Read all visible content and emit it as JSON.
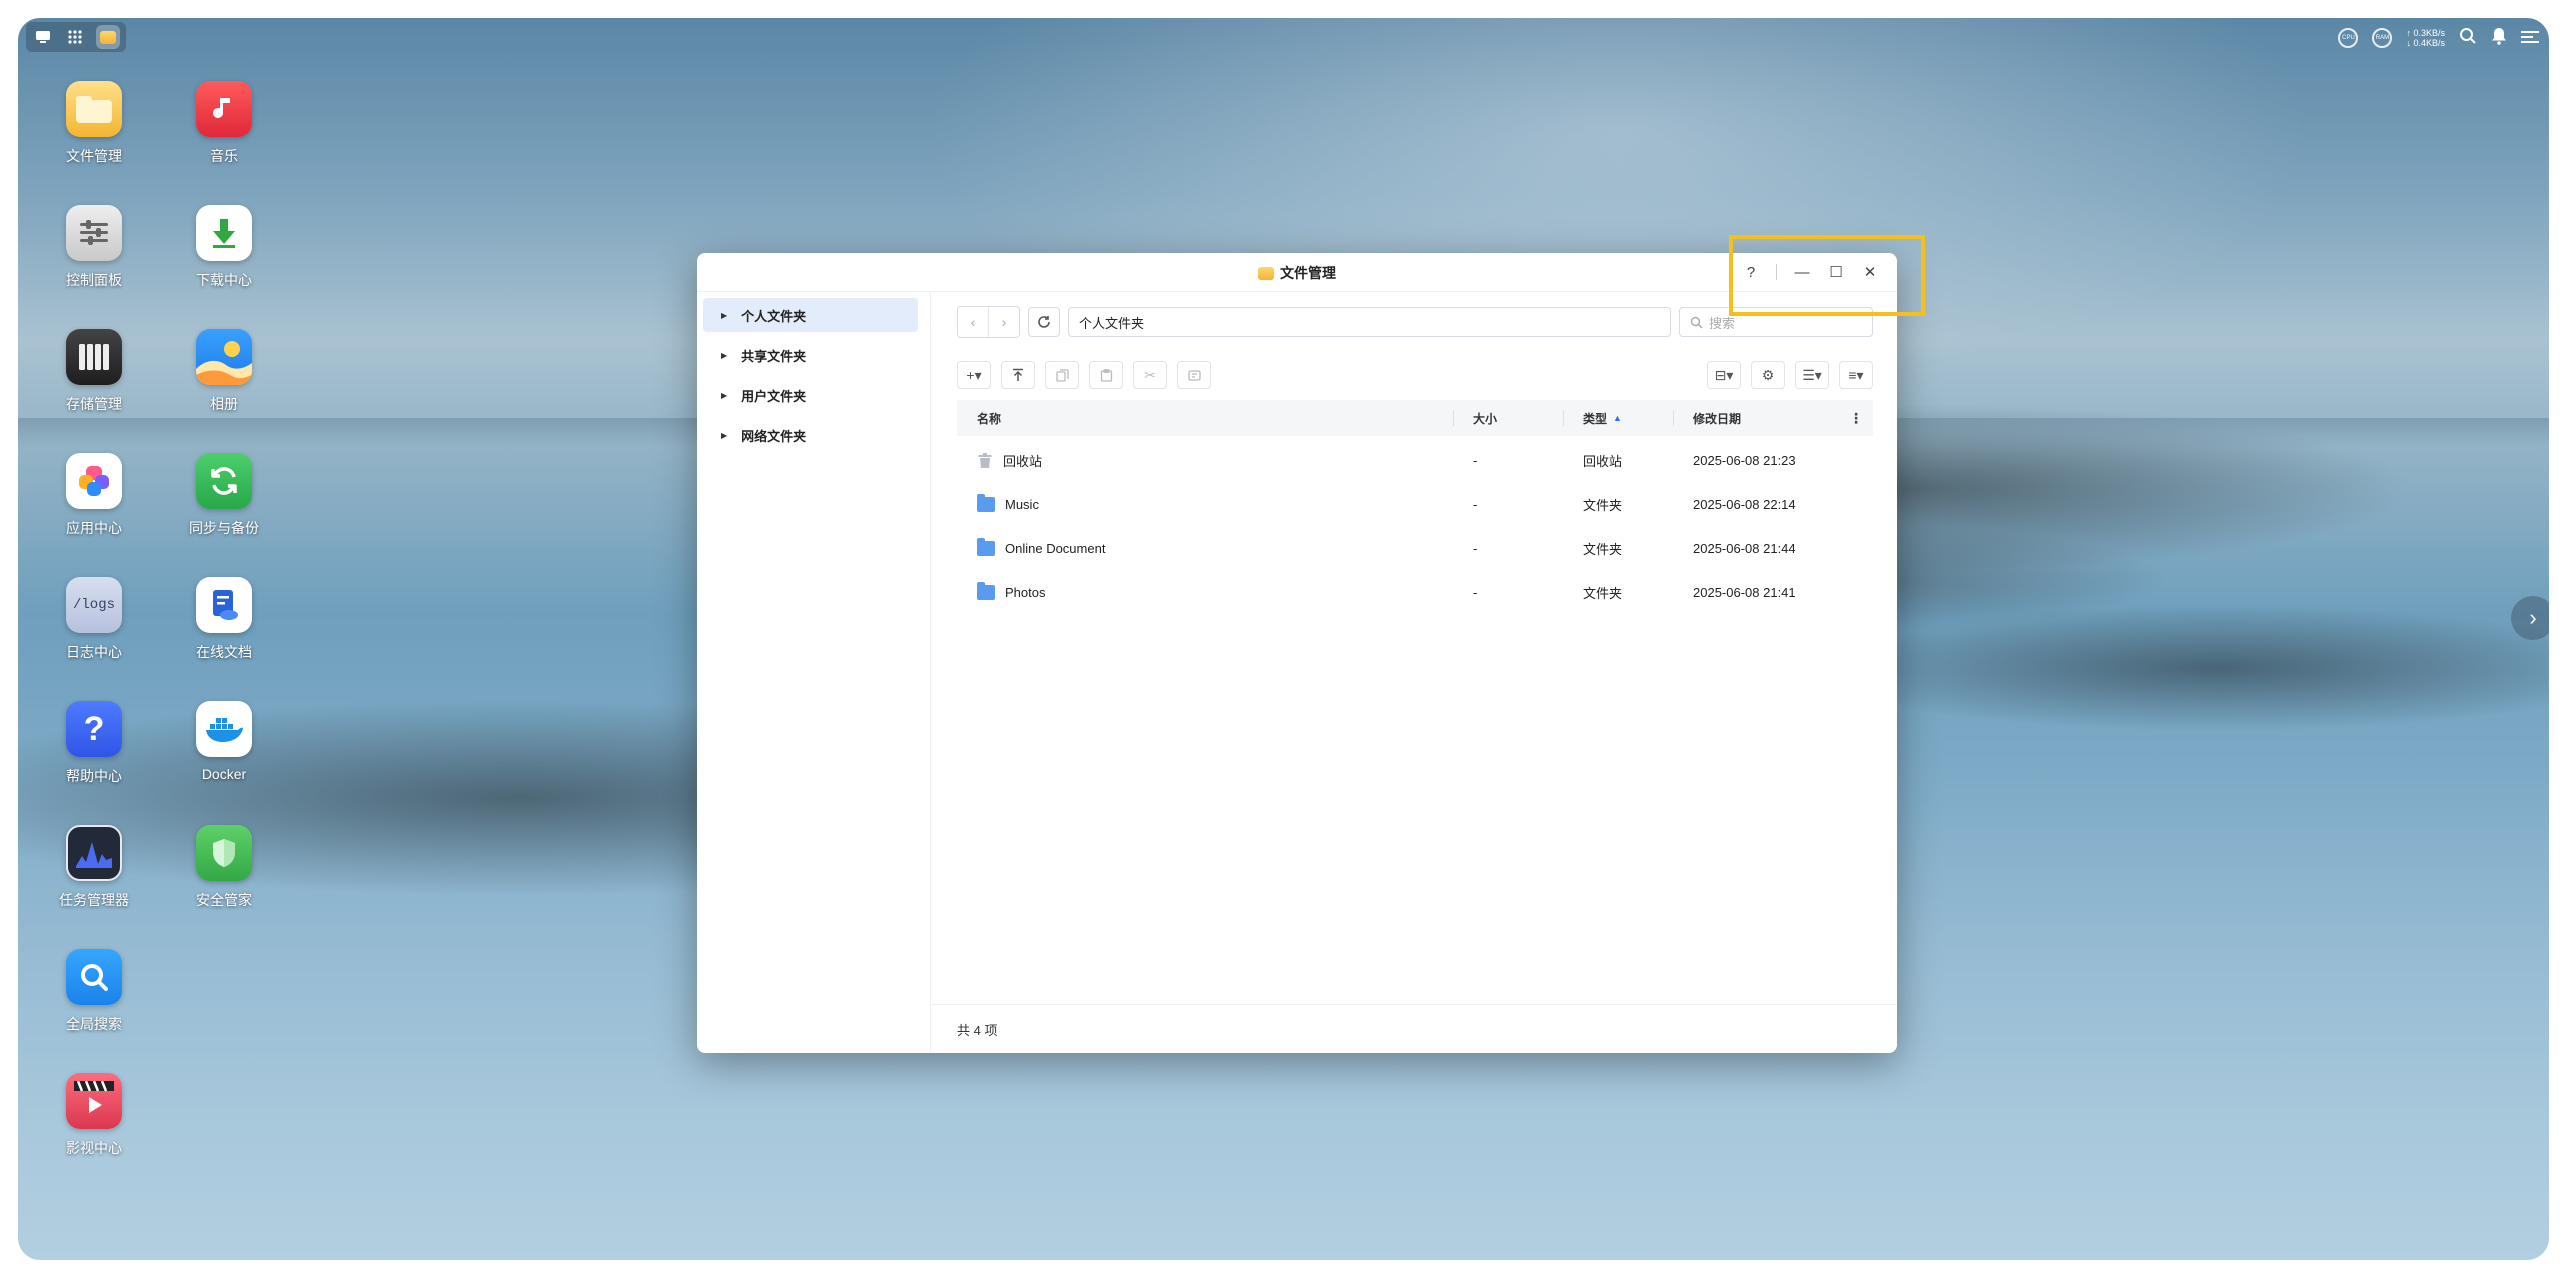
{
  "desktop": {
    "icons": [
      {
        "label": "文件管理",
        "icon": "file-manager-icon"
      },
      {
        "label": "音乐",
        "icon": "music-icon"
      },
      {
        "label": "控制面板",
        "icon": "control-panel-icon"
      },
      {
        "label": "下载中心",
        "icon": "download-center-icon"
      },
      {
        "label": "存储管理",
        "icon": "storage-manager-icon"
      },
      {
        "label": "相册",
        "icon": "photos-icon"
      },
      {
        "label": "应用中心",
        "icon": "app-center-icon"
      },
      {
        "label": "同步与备份",
        "icon": "sync-backup-icon"
      },
      {
        "label": "日志中心",
        "icon": "log-center-icon",
        "glyph": "/logs"
      },
      {
        "label": "在线文档",
        "icon": "online-docs-icon"
      },
      {
        "label": "帮助中心",
        "icon": "help-center-icon",
        "glyph": "?"
      },
      {
        "label": "Docker",
        "icon": "docker-icon"
      },
      {
        "label": "任务管理器",
        "icon": "task-manager-icon"
      },
      {
        "label": "安全管家",
        "icon": "security-icon"
      },
      {
        "label": "全局搜索",
        "icon": "global-search-icon"
      },
      {
        "label": "影视中心",
        "icon": "video-center-icon"
      }
    ]
  },
  "topbar": {
    "gauge_cpu": "CPU",
    "gauge_ram": "RAM",
    "net_up": "↑ 0.3KB/s",
    "net_down": "↓ 0.4KB/s"
  },
  "window": {
    "title": "文件管理",
    "controls": {
      "help": "?",
      "minimize": "—",
      "maximize": "☐",
      "close": "✕"
    },
    "sidebar": [
      {
        "label": "个人文件夹",
        "active": true
      },
      {
        "label": "共享文件夹",
        "active": false
      },
      {
        "label": "用户文件夹",
        "active": false
      },
      {
        "label": "网络文件夹",
        "active": false
      }
    ],
    "path": "个人文件夹",
    "search_placeholder": "搜索",
    "columns": {
      "name": "名称",
      "size": "大小",
      "type": "类型",
      "date": "修改日期"
    },
    "rows": [
      {
        "name": "回收站",
        "size": "-",
        "type": "回收站",
        "date": "2025-06-08 21:23",
        "icon": "trash-icon"
      },
      {
        "name": "Music",
        "size": "-",
        "type": "文件夹",
        "date": "2025-06-08 22:14",
        "icon": "music-folder-icon"
      },
      {
        "name": "Online Document",
        "size": "-",
        "type": "文件夹",
        "date": "2025-06-08 21:44",
        "icon": "folder-icon"
      },
      {
        "name": "Photos",
        "size": "-",
        "type": "文件夹",
        "date": "2025-06-08 21:41",
        "icon": "photos-folder-icon"
      }
    ],
    "footer": "共 4 项"
  },
  "colors": {
    "accent": "#2f6fe4",
    "highlight": "#f4c01e",
    "folder": "#5b9bef",
    "sidebar_active": "#e3ecfb"
  }
}
